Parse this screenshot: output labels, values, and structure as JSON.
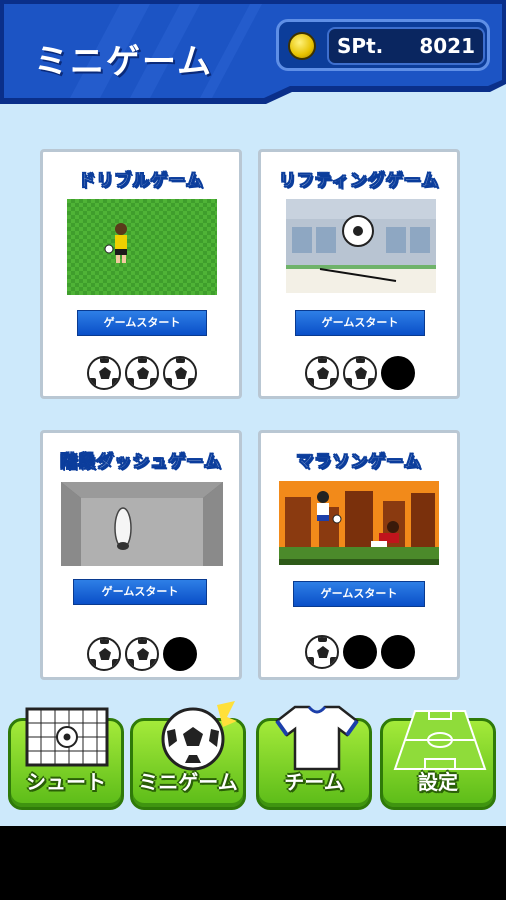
{
  "header": {
    "title": "ミニゲーム",
    "spt_label": "SPt.",
    "spt_value": "8021",
    "coin_icon": "gold-coin-icon"
  },
  "games": [
    {
      "title": "ドリブルゲーム",
      "button": "ゲームスタート",
      "rating": 3,
      "max_rating": 3
    },
    {
      "title": "リフティングゲーム",
      "button": "ゲームスタート",
      "rating": 2,
      "max_rating": 3
    },
    {
      "title": "階段ダッシュゲーム",
      "button": "ゲームスタート",
      "rating": 2,
      "max_rating": 3
    },
    {
      "title": "マラソンゲーム",
      "button": "ゲームスタート",
      "rating": 1,
      "max_rating": 3
    }
  ],
  "nav": [
    {
      "label": "シュート",
      "icon": "goal-net-icon"
    },
    {
      "label": "ミニゲーム",
      "icon": "soccer-ball-icon"
    },
    {
      "label": "チーム",
      "icon": "jersey-icon"
    },
    {
      "label": "設定",
      "icon": "field-icon"
    }
  ],
  "colors": {
    "background": "#cde9fb",
    "header_blue": "#1848b8",
    "button_blue": "#0a4fc8",
    "nav_green": "#6cc51e"
  }
}
